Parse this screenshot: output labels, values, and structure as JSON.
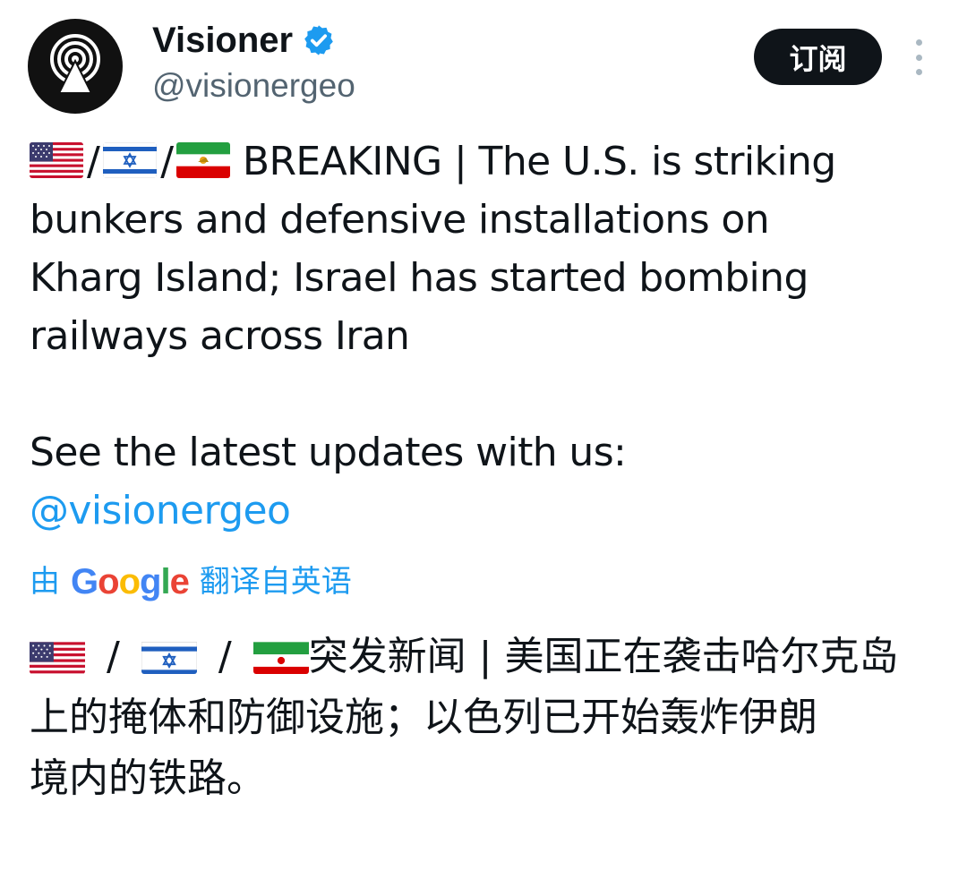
{
  "author": {
    "display_name": "Visioner",
    "handle": "@visionergeo",
    "verified_icon": "verified-badge-icon",
    "avatar_icon": "broadcast-tower-icon"
  },
  "actions": {
    "subscribe_label": "订阅",
    "more_icon": "more-vertical-icon"
  },
  "tweet": {
    "flags": [
      "us-flag-icon",
      "israel-flag-icon",
      "iran-flag-icon"
    ],
    "separator": "/",
    "line1": "BREAKING | The U.S. is striking",
    "line2": "bunkers and defensive installations on",
    "line3": "Kharg Island; Israel has started bombing",
    "line4": "railways across Iran",
    "line5": "See the latest updates with us:",
    "mention": "@visionergeo"
  },
  "translation_note": {
    "prefix": "由",
    "brand": "Google",
    "suffix": "翻译自英语"
  },
  "translation": {
    "separator": "/",
    "line1": "突发新闻 | 美国正在袭击哈尔克岛",
    "line2": "上的掩体和防御设施；以色列已开始轰炸伊朗",
    "line3": "境内的铁路。"
  },
  "colors": {
    "text": "#0f1419",
    "secondary": "#536471",
    "link": "#1d9bf0",
    "button_bg": "#0f1419"
  }
}
